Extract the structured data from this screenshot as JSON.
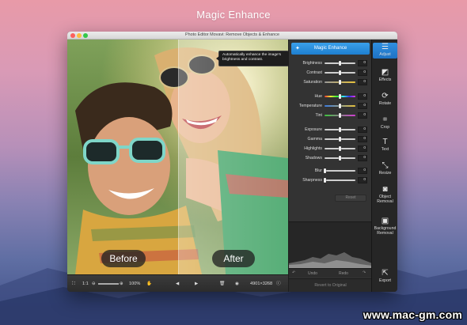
{
  "hero_title": "Magic Enhance",
  "window": {
    "title": "Photo Editor Movavi: Remove Objects & Enhance"
  },
  "canvas": {
    "before_label": "Before",
    "after_label": "After",
    "tooltip": "Automatically enhance the image's brightness and contrast."
  },
  "bottom_bar": {
    "zoom_1to1": "1:1",
    "zoom_percent": "100%",
    "dimensions": "4901×3268"
  },
  "panel": {
    "magic_enhance_label": "Magic Enhance",
    "sliders": [
      {
        "label": "Brightness",
        "value": "0",
        "level": 0.5,
        "track": "#cfcfcf"
      },
      {
        "label": "Contrast",
        "value": "0",
        "level": 0.5,
        "track": "#cfcfcf"
      },
      {
        "label": "Saturation",
        "value": "0",
        "level": 0.5,
        "track": "linear-gradient(90deg,#999,#e8c23a)"
      },
      {
        "label": "Hue",
        "value": "0",
        "level": 0.5,
        "track": "linear-gradient(90deg,#e33,#ee3,#3e3,#3ee,#33e,#e3e)"
      },
      {
        "label": "Temperature",
        "value": "0",
        "level": 0.5,
        "track": "linear-gradient(90deg,#3a7be0,#e8c23a)"
      },
      {
        "label": "Tint",
        "value": "0",
        "level": 0.5,
        "track": "linear-gradient(90deg,#3cc43c,#d33bd3)"
      },
      {
        "label": "Exposure",
        "value": "0",
        "level": 0.5,
        "track": "#cfcfcf"
      },
      {
        "label": "Gamma",
        "value": "0",
        "level": 0.5,
        "track": "#cfcfcf"
      },
      {
        "label": "Highlights",
        "value": "0",
        "level": 0.5,
        "track": "#cfcfcf"
      },
      {
        "label": "Shadows",
        "value": "0",
        "level": 0.5,
        "track": "#cfcfcf"
      },
      {
        "label": "Blur",
        "value": "0",
        "level": 0.0,
        "track": "#cfcfcf"
      },
      {
        "label": "Sharpness",
        "value": "0",
        "level": 0.0,
        "track": "#cfcfcf"
      }
    ],
    "reset_label": "Reset",
    "undo_label": "Undo",
    "redo_label": "Redo",
    "revert_label": "Revert to Original"
  },
  "toolbar": {
    "tools": [
      {
        "label": "Adjust",
        "icon": "sliders-icon"
      },
      {
        "label": "Effects",
        "icon": "effects-icon"
      },
      {
        "label": "Rotate",
        "icon": "rotate-icon"
      },
      {
        "label": "Crop",
        "icon": "crop-icon"
      },
      {
        "label": "Text",
        "icon": "text-icon"
      },
      {
        "label": "Resize",
        "icon": "resize-icon"
      },
      {
        "label": "Object Removal",
        "icon": "object-removal-icon"
      },
      {
        "label": "Background Removal",
        "icon": "background-removal-icon"
      }
    ],
    "export_label": "Export"
  },
  "watermark": "www.mac-gm.com"
}
